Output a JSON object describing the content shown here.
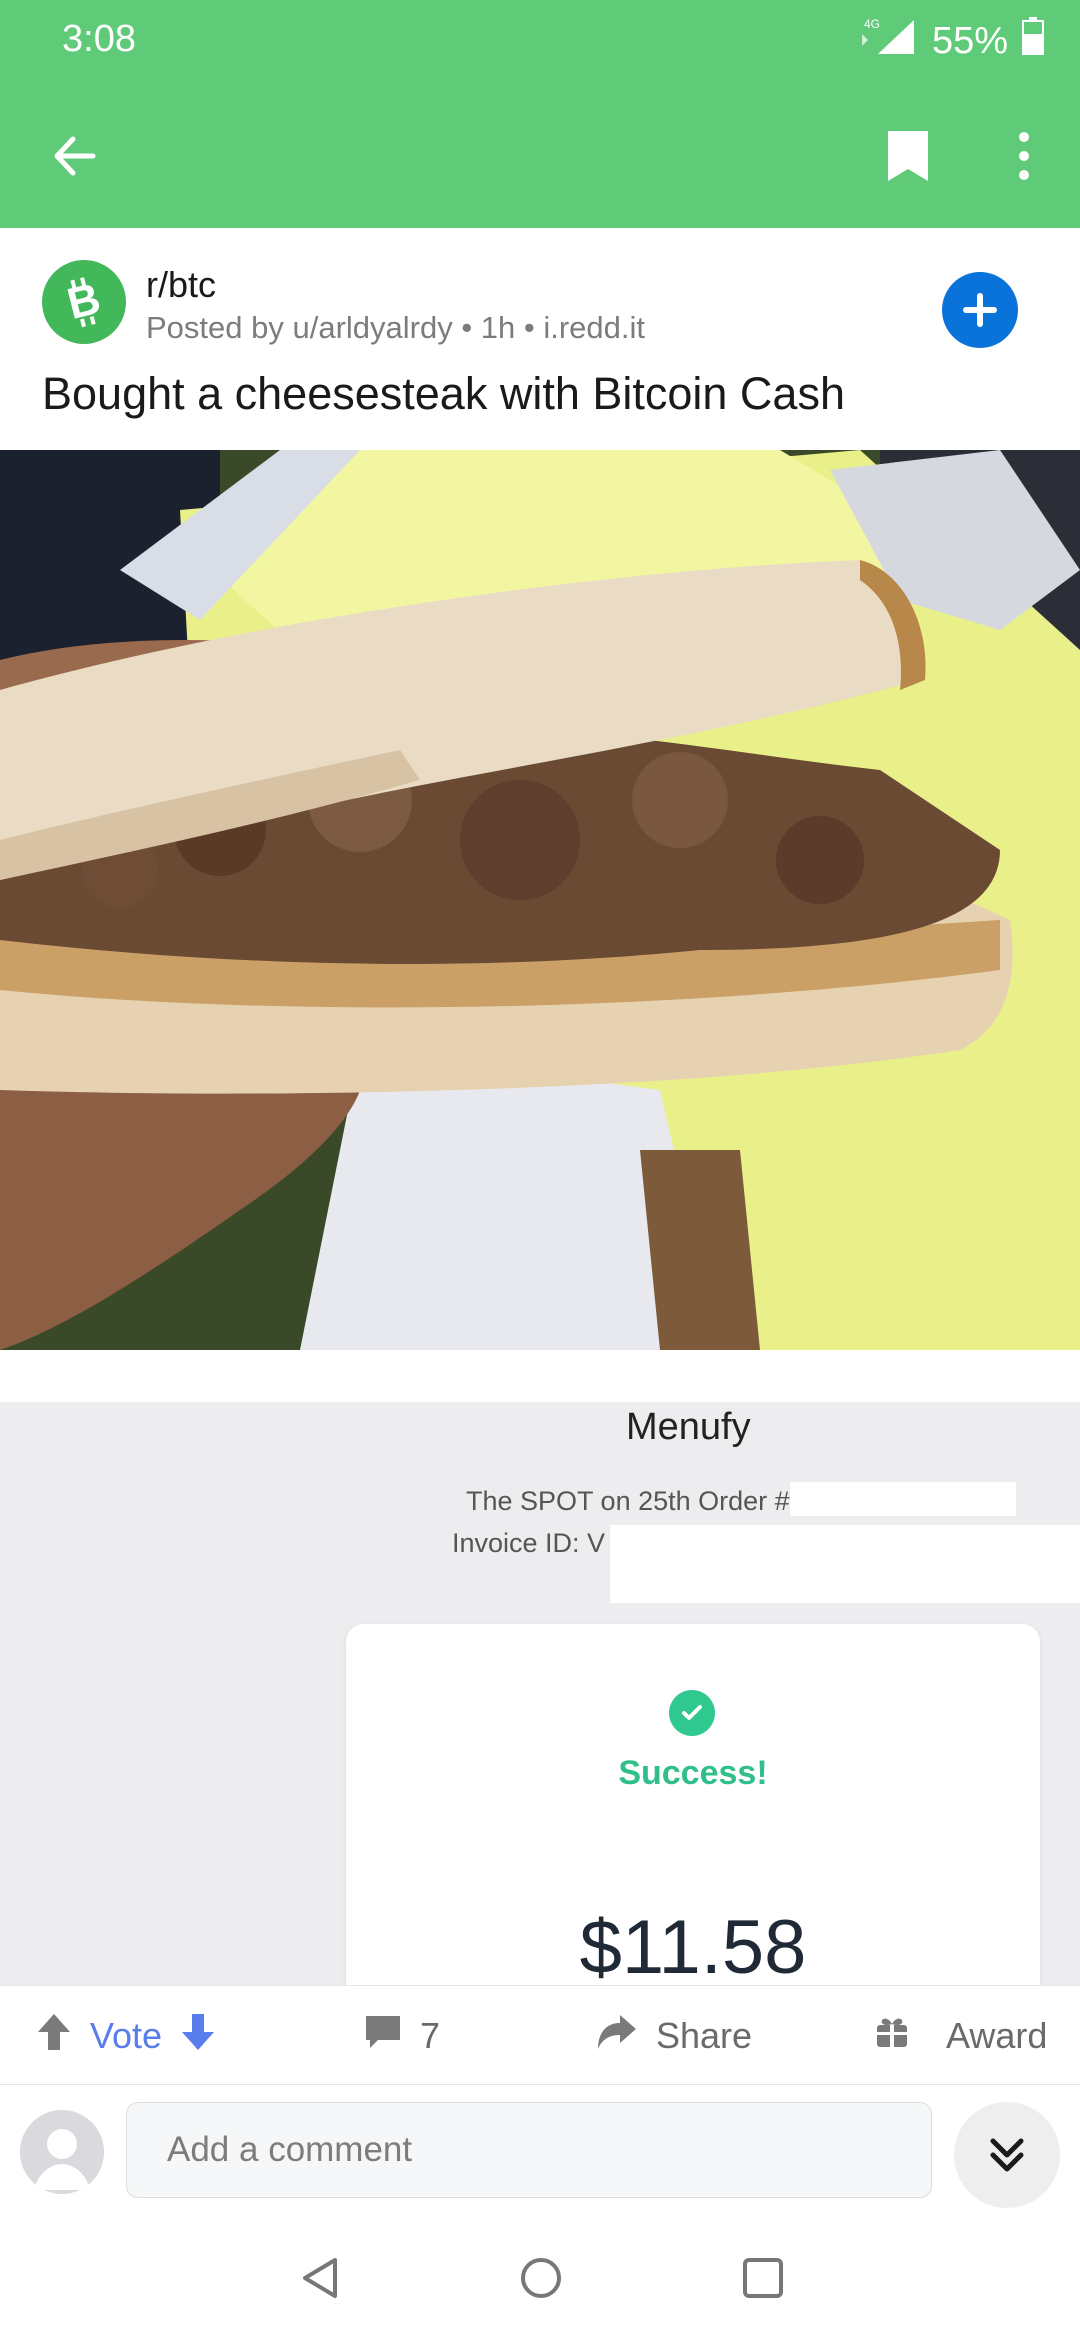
{
  "status_bar": {
    "time": "3:08",
    "network": "4G",
    "battery": "55%"
  },
  "app_bar": {
    "back_icon": "arrow-left-icon",
    "bookmark_icon": "bookmark-icon",
    "more_icon": "more-vertical-icon",
    "color": "#5fcb78"
  },
  "post": {
    "subreddit": "r/btc",
    "meta": "Posted by u/arldyalrdy • 1h • i.redd.it",
    "title": "Bought a cheesesteak with Bitcoin Cash",
    "subreddit_icon": "bitcoin-cash-icon",
    "join_icon": "plus-icon"
  },
  "receipt": {
    "merchant": "Menufy",
    "order_line": "The SPOT on 25th Order #",
    "invoice_line": "Invoice ID: V",
    "status": "Success!",
    "amount": "$11.58"
  },
  "actions": {
    "vote": "Vote",
    "comments": "7",
    "share": "Share",
    "award": "Award"
  },
  "comment_bar": {
    "placeholder": "Add a comment"
  }
}
